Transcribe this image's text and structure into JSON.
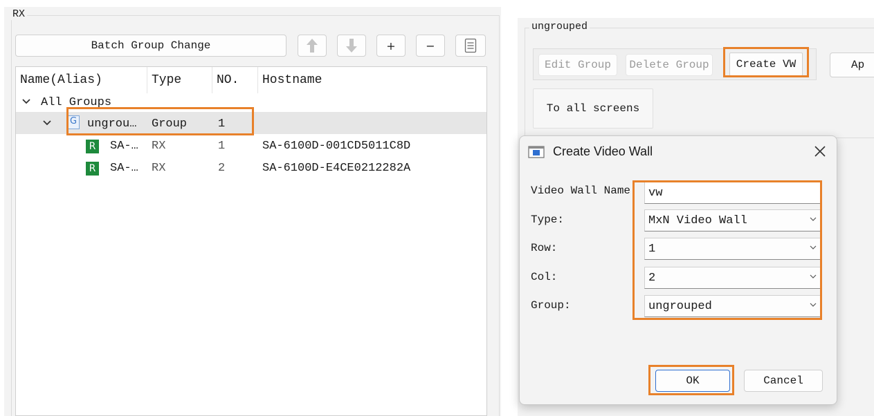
{
  "rx_panel": {
    "legend": "RX",
    "toolbar": {
      "batch_label": "Batch Group Change",
      "add_label": "+",
      "remove_label": "−"
    },
    "tree": {
      "columns": [
        "Name(Alias)",
        "Type",
        "NO.",
        "Hostname"
      ],
      "root_label": "All Groups",
      "group": {
        "badge": "G",
        "name": "ungrou…",
        "type": "Group",
        "no": "1"
      },
      "devices": [
        {
          "badge": "R",
          "name": "SA-…",
          "type": "RX",
          "no": "1",
          "hostname": "SA-6100D-001CD5011C8D"
        },
        {
          "badge": "R",
          "name": "SA-…",
          "type": "RX",
          "no": "2",
          "hostname": "SA-6100D-E4CE0212282A"
        }
      ]
    }
  },
  "group_panel": {
    "legend": "ungrouped",
    "buttons": {
      "edit": "Edit Group",
      "delete": "Delete Group",
      "create_vw": "Create VW",
      "apply": "Ap",
      "to_all": "To all screens"
    }
  },
  "dialog": {
    "title": "Create Video Wall",
    "fields": {
      "name": {
        "label": "Video Wall Name:",
        "value": "vw"
      },
      "type": {
        "label": "Type:",
        "value": "MxN Video Wall"
      },
      "row": {
        "label": "Row:",
        "value": "1"
      },
      "col": {
        "label": "Col:",
        "value": "2"
      },
      "group": {
        "label": "Group:",
        "value": "ungrouped"
      }
    },
    "ok_label": "OK",
    "cancel_label": "Cancel"
  },
  "colors": {
    "highlight": "#e8812a",
    "group_badge": "#3b78c9",
    "rx_badge": "#1e8a3c"
  }
}
